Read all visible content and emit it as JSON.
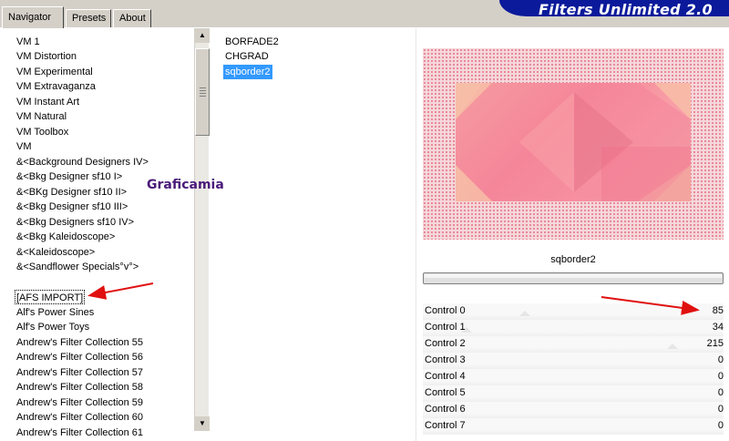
{
  "tabs": {
    "navigator": "Navigator",
    "presets": "Presets",
    "about": "About"
  },
  "banner": {
    "title": "Filters Unlimited 2.0"
  },
  "categories": [
    "VM 1",
    "VM Distortion",
    "VM Experimental",
    "VM Extravaganza",
    "VM Instant Art",
    "VM Natural",
    "VM Toolbox",
    "VM",
    "&<Background Designers IV>",
    "&<Bkg Designer sf10 I>",
    "&<BKg Designer sf10 II>",
    "&<Bkg Designer sf10 III>",
    "&<Bkg Designers sf10 IV>",
    "&<Bkg Kaleidoscope>",
    "&<Kaleidoscope>",
    "&<Sandflower Specials°v°>",
    "",
    "[AFS IMPORT]",
    "Alf's Power Sines",
    "Alf's Power Toys",
    "Andrew's Filter Collection 55",
    "Andrew's Filter Collection 56",
    "Andrew's Filter Collection 57",
    "Andrew's Filter Collection 58",
    "Andrew's Filter Collection 59",
    "Andrew's Filter Collection 60",
    "Andrew's Filter Collection 61"
  ],
  "filters": [
    "BORFADE2",
    "CHGRAD",
    "sqborder2"
  ],
  "watermark": "Graficamia",
  "selected_filter": "sqborder2",
  "controls": [
    {
      "label": "Control 0",
      "value": "85",
      "level": 85
    },
    {
      "label": "Control 1",
      "value": "34",
      "level": 34
    },
    {
      "label": "Control 2",
      "value": "215",
      "level": 215
    },
    {
      "label": "Control 3",
      "value": "0",
      "level": 0
    },
    {
      "label": "Control 4",
      "value": "0",
      "level": 0
    },
    {
      "label": "Control 5",
      "value": "0",
      "level": 0
    },
    {
      "label": "Control 6",
      "value": "0",
      "level": 0
    },
    {
      "label": "Control 7",
      "value": "0",
      "level": 0
    }
  ],
  "colors": {
    "banner": "#0a1a9a",
    "selection": "#3399ff",
    "arrow": "#e01010",
    "watermark": "#4a1a7a"
  },
  "icons": {
    "scroll_up": "triangle-up",
    "scroll_down": "triangle-down"
  }
}
